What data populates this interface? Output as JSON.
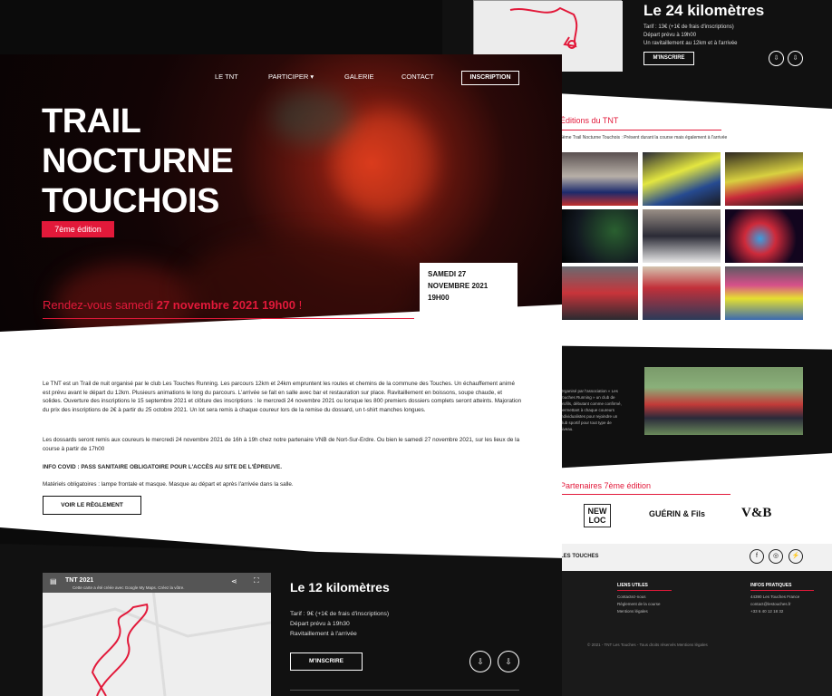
{
  "back_page": {
    "route_24": {
      "title": "Le 24 kilomètres",
      "lines": [
        "Tarif : 13€ (+1€ de frais d'inscriptions)",
        "Départ prévu à 19h00",
        "Un ravitaillement au 12km et à l'arrivée"
      ],
      "button": "M'INSCRIRE"
    },
    "gallery": {
      "title": "Éditions du TNT",
      "subtitle": "6ème Trail Nocturne Touchois : Présent durant la course mais également à l'arrivée"
    },
    "club_text": "Organisé par l'association « Les Touches Running » un club de profils, débutant comme confirmé, permettant à chaque coureurs individualistes pour rejoindre un club sportif pour tout type de niveau.",
    "partners": {
      "title": "Partenaires 7ème édition",
      "logos": [
        "NEW LOC",
        "GUÉRIN & Fils",
        "V&B"
      ]
    },
    "footer": {
      "social_text": "LES TOUCHES",
      "links_title": "LIENS UTILES",
      "links": [
        "Contactez-nous",
        "Règlement de la course",
        "Mentions légales"
      ],
      "info_title": "INFOS PRATIQUES",
      "info": [
        "44390 Les Touches France",
        "contact@lestouches.fr",
        "+33 6 40 12 18 32"
      ],
      "copyright": "© 2021 - TNT Les Touches - Tous droits réservés Mentions légales"
    }
  },
  "nav": {
    "items": [
      "LE TNT",
      "PARTICIPER",
      "GALERIE",
      "CONTACT"
    ],
    "cta": "INSCRIPTION"
  },
  "hero": {
    "title_lines": [
      "TRAIL",
      "NOCTURNE",
      "TOUCHOIS"
    ],
    "edition": "7ème édition",
    "date_lines": [
      "SAMEDI 27",
      "NOVEMBRE 2021",
      "19H00"
    ]
  },
  "intro": {
    "heading_prefix": "Rendez-vous samedi ",
    "heading_bold": "27 novembre 2021 19h00",
    "heading_suffix": " !",
    "p1": "Le TNT est un Trail de nuit organisé par le club Les Touches Running. Les parcours 12km et 24km empruntent les routes et chemins de la commune des Touches. Un échauffement animé est prévu avant le départ du 12km. Plusieurs animations le long du parcours. L'arrivée se fait en salle avec bar et restauration sur place. Ravitaillement en boissons, soupe chaude, et solides. Ouverture des inscriptions le 15 septembre 2021 et clôture des inscriptions : le mercredi 24 novembre 2021 ou lorsque les 800 premiers dossiers complets seront atteints. Majoration du prix des inscriptions de 2€ à partir du 25 octobre 2021. Un lot sera remis à chaque coureur lors de la remise du dossard, un t-shirt manches longues.",
    "p2": "Les dossards seront remis aux coureurs le mercredi 24 novembre 2021 de 16h à 19h chez notre partenaire VNB de Nort-Sur-Erdre. Ou bien le samedi 27 novembre 2021, sur les lieux de la course à partir de 17h00",
    "p3": "INFO COVID : PASS SANITAIRE OBLIGATOIRE POUR L'ACCÈS AU SITE DE L'ÉPREUVE.",
    "p4": "Matériels obligatoires : lampe frontale et masque. Masque au départ et après l'arrivée dans la salle.",
    "button": "VOIR LE RÈGLEMENT"
  },
  "route_12": {
    "map_title": "TNT 2021",
    "map_subtitle": "Cette carte a été créée avec Google My Maps. Créez la vôtre.",
    "title": "Le 12 kilomètres",
    "lines": [
      "Tarif : 9€ (+1€ de frais d'inscriptions)",
      "Départ prévu à 19h30",
      "Ravitaillement à l'arrivée"
    ],
    "button": "M'INSCRIRE"
  }
}
